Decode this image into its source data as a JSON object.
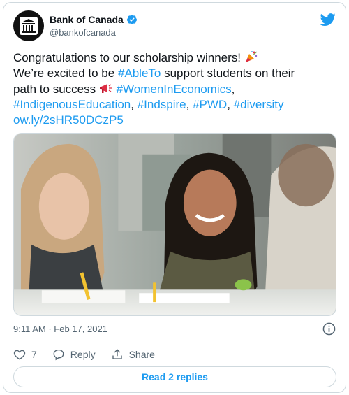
{
  "author": {
    "display_name": "Bank of Canada",
    "handle": "@bankofcanada",
    "verified": true,
    "avatar_icon": "bank-building-icon"
  },
  "brand_icon": "twitter-bird-icon",
  "tweet": {
    "line1_text": "Congratulations to our scholarship winners!",
    "line1_emoji": "party-popper-icon",
    "line2_prefix": "We’re excited to be ",
    "line2_hashtag": "#AbleTo",
    "line2_suffix": " support students on their",
    "line3_prefix": "path to success ",
    "line3_emoji": "megaphone-icon",
    "line3_hashtag": "#WomenInEconomics",
    "line3_suffix": ",",
    "line4_tag1": "#IndigenousEducation",
    "line4_sep1": ", ",
    "line4_tag2": "#Indspire",
    "line4_sep2": ", ",
    "line4_tag3": "#PWD",
    "line4_sep3": ", ",
    "line4_tag4": "#diversity",
    "line5_link": "ow.ly/2sHR50DCzP5"
  },
  "timestamp": "9:11 AM · Feb 17, 2021",
  "actions": {
    "like_count": "7",
    "reply_label": "Reply",
    "share_label": "Share"
  },
  "read_replies_label": "Read 2 replies",
  "colors": {
    "accent": "#1d9bf0",
    "text": "#0f1419",
    "muted": "#536471",
    "border": "#cfd9de"
  }
}
